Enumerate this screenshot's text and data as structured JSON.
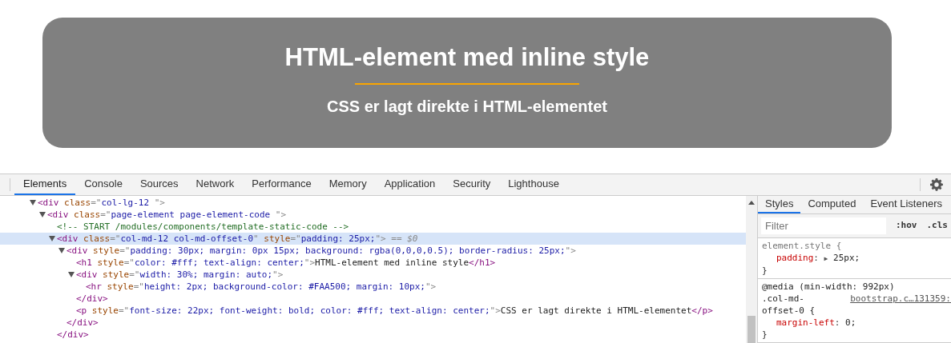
{
  "hero": {
    "title": "HTML-element med inline style",
    "subtitle": "CSS er lagt direkte i HTML-elementet"
  },
  "devtools": {
    "tabs": [
      {
        "label": "Elements",
        "selected": true
      },
      {
        "label": "Console",
        "selected": false
      },
      {
        "label": "Sources",
        "selected": false
      },
      {
        "label": "Network",
        "selected": false
      },
      {
        "label": "Performance",
        "selected": false
      },
      {
        "label": "Memory",
        "selected": false
      },
      {
        "label": "Application",
        "selected": false
      },
      {
        "label": "Security",
        "selected": false
      },
      {
        "label": "Lighthouse",
        "selected": false
      }
    ],
    "dom_tree": [
      {
        "kind": "element",
        "expanded": true,
        "selected": false,
        "tokens": [
          {
            "kind": "tag",
            "text": "<div"
          },
          {
            "kind": "attr",
            "text": " class"
          },
          {
            "kind": "punct",
            "text": "=\""
          },
          {
            "kind": "value",
            "text": "col-lg-12 "
          },
          {
            "kind": "punct",
            "text": "\">"
          }
        ],
        "children": [
          {
            "kind": "element",
            "expanded": true,
            "selected": false,
            "tokens": [
              {
                "kind": "tag",
                "text": "<div"
              },
              {
                "kind": "attr",
                "text": " class"
              },
              {
                "kind": "punct",
                "text": "=\""
              },
              {
                "kind": "value",
                "text": "page-element page-element-code "
              },
              {
                "kind": "punct",
                "text": "\">"
              }
            ],
            "children": [
              {
                "kind": "comment",
                "selected": false,
                "tokens": [
                  {
                    "kind": "comment",
                    "text": "<!-- START /modules/components/template-static-code -->"
                  }
                ]
              },
              {
                "kind": "element",
                "expanded": true,
                "selected": true,
                "tokens": [
                  {
                    "kind": "tag",
                    "text": "<div"
                  },
                  {
                    "kind": "attr",
                    "text": " class"
                  },
                  {
                    "kind": "punct",
                    "text": "=\""
                  },
                  {
                    "kind": "value",
                    "text": "col-md-12 col-md-offset-0"
                  },
                  {
                    "kind": "punct",
                    "text": "\""
                  },
                  {
                    "kind": "attr",
                    "text": " style"
                  },
                  {
                    "kind": "punct",
                    "text": "=\""
                  },
                  {
                    "kind": "value",
                    "text": "padding: 25px;"
                  },
                  {
                    "kind": "punct",
                    "text": "\">"
                  },
                  {
                    "kind": "marker",
                    "text": " == $0"
                  }
                ],
                "children": [
                  {
                    "kind": "element",
                    "expanded": true,
                    "selected": false,
                    "tokens": [
                      {
                        "kind": "tag",
                        "text": "<div"
                      },
                      {
                        "kind": "attr",
                        "text": " style"
                      },
                      {
                        "kind": "punct",
                        "text": "=\""
                      },
                      {
                        "kind": "value",
                        "text": "padding: 30px; margin: 0px 15px; background: rgba(0,0,0,0.5); border-radius: 25px;"
                      },
                      {
                        "kind": "punct",
                        "text": "\">"
                      }
                    ],
                    "children": [
                      {
                        "kind": "leaf",
                        "selected": false,
                        "tokens": [
                          {
                            "kind": "tag",
                            "text": "<h1"
                          },
                          {
                            "kind": "attr",
                            "text": " style"
                          },
                          {
                            "kind": "punct",
                            "text": "=\""
                          },
                          {
                            "kind": "value",
                            "text": "color: #fff; text-align: center;"
                          },
                          {
                            "kind": "punct",
                            "text": "\">"
                          },
                          {
                            "kind": "text",
                            "text": "HTML-element med inline style"
                          },
                          {
                            "kind": "tag",
                            "text": "</h1>"
                          }
                        ]
                      },
                      {
                        "kind": "element",
                        "expanded": true,
                        "selected": false,
                        "tokens": [
                          {
                            "kind": "tag",
                            "text": "<div"
                          },
                          {
                            "kind": "attr",
                            "text": " style"
                          },
                          {
                            "kind": "punct",
                            "text": "=\""
                          },
                          {
                            "kind": "value",
                            "text": "width: 30%; margin: auto;"
                          },
                          {
                            "kind": "punct",
                            "text": "\">"
                          }
                        ],
                        "children": [
                          {
                            "kind": "leaf",
                            "selected": false,
                            "tokens": [
                              {
                                "kind": "tag",
                                "text": "<hr"
                              },
                              {
                                "kind": "attr",
                                "text": " style"
                              },
                              {
                                "kind": "punct",
                                "text": "=\""
                              },
                              {
                                "kind": "value",
                                "text": "height: 2px; background-color: #FAA500; margin: 10px;"
                              },
                              {
                                "kind": "punct",
                                "text": "\">"
                              }
                            ]
                          }
                        ],
                        "end": [
                          {
                            "kind": "tag",
                            "text": "</div>"
                          }
                        ]
                      },
                      {
                        "kind": "leaf",
                        "selected": false,
                        "tokens": [
                          {
                            "kind": "tag",
                            "text": "<p"
                          },
                          {
                            "kind": "attr",
                            "text": " style"
                          },
                          {
                            "kind": "punct",
                            "text": "=\""
                          },
                          {
                            "kind": "value",
                            "text": "font-size: 22px; font-weight: bold; color: #fff; text-align: center;"
                          },
                          {
                            "kind": "punct",
                            "text": "\">"
                          },
                          {
                            "kind": "text",
                            "text": "CSS er lagt direkte i HTML-elementet"
                          },
                          {
                            "kind": "tag",
                            "text": "</p>"
                          }
                        ]
                      }
                    ],
                    "end": [
                      {
                        "kind": "tag",
                        "text": "</div>"
                      }
                    ]
                  }
                ],
                "end": [
                  {
                    "kind": "tag",
                    "text": "</div>"
                  }
                ]
              }
            ]
          }
        ]
      }
    ],
    "styles_panel": {
      "tabs": [
        {
          "label": "Styles",
          "selected": true
        },
        {
          "label": "Computed",
          "selected": false
        },
        {
          "label": "Event Listeners",
          "selected": false
        }
      ],
      "filter": {
        "placeholder": "Filter"
      },
      "toggles": [
        ":hov",
        ".cls"
      ],
      "rules": [
        {
          "lines": [
            {
              "kind": "selector",
              "tokens": [
                {
                  "kind": "selector",
                  "text": "element.style {"
                }
              ]
            },
            {
              "kind": "decl",
              "tokens": [
                {
                  "kind": "prop",
                  "text": "padding"
                },
                {
                  "kind": "punct",
                  "text": ": "
                },
                {
                  "kind": "expander",
                  "text": "▶"
                },
                {
                  "kind": "value",
                  "text": " 25px;"
                }
              ]
            },
            {
              "kind": "brace",
              "tokens": [
                {
                  "kind": "punct",
                  "text": "}"
                }
              ]
            }
          ]
        },
        {
          "lines": [
            {
              "kind": "selector",
              "tokens": [
                {
                  "kind": "selector",
                  "text": "@media (min-width: 992px)"
                }
              ]
            },
            {
              "kind": "selector",
              "tokens": [
                {
                  "kind": "selector",
                  "text": ".col-md-"
                },
                {
                  "kind": "source",
                  "text": "bootstrap.c…131359:"
                }
              ]
            },
            {
              "kind": "selector",
              "tokens": [
                {
                  "kind": "selector",
                  "text": "offset-0 {"
                }
              ]
            },
            {
              "kind": "decl",
              "tokens": [
                {
                  "kind": "prop",
                  "text": "margin-left"
                },
                {
                  "kind": "punct",
                  "text": ": "
                },
                {
                  "kind": "value",
                  "text": "0;"
                }
              ]
            },
            {
              "kind": "brace",
              "tokens": [
                {
                  "kind": "punct",
                  "text": "}"
                }
              ]
            }
          ]
        }
      ]
    }
  }
}
